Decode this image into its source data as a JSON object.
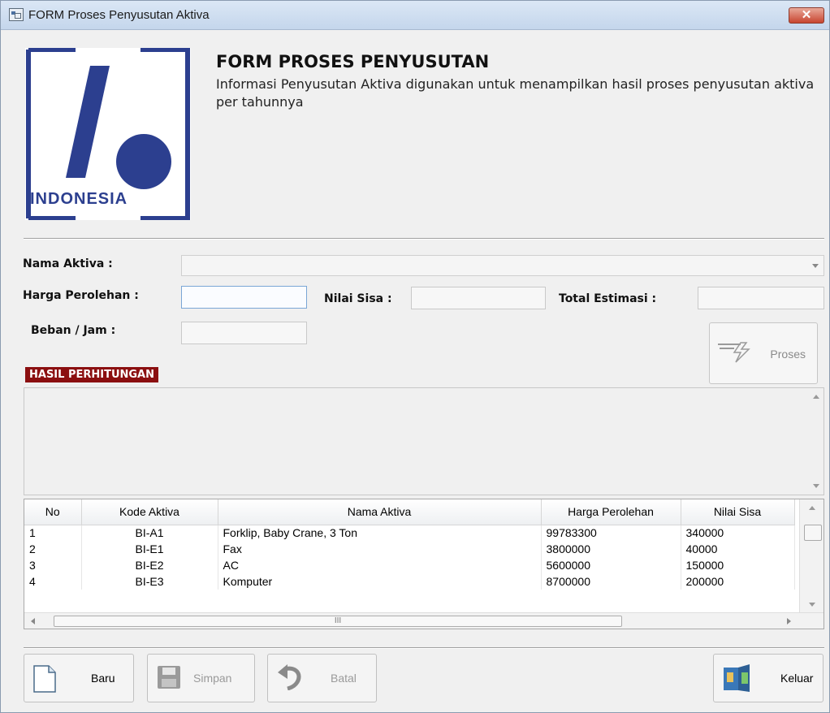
{
  "window": {
    "title": "FORM Proses  Penyusutan Aktiva",
    "close_label": "✕"
  },
  "logo": {
    "text": "INDONESIA"
  },
  "header": {
    "title": "FORM PROSES PENYUSUTAN",
    "description": "Informasi Penyusutan Aktiva digunakan untuk menampilkan hasil proses penyusutan aktiva per tahunnya"
  },
  "form": {
    "nama_aktiva_label": "Nama Aktiva :",
    "nama_aktiva_value": "",
    "harga_perolehan_label": "Harga Perolehan :",
    "nilai_sisa_label": "Nilai Sisa :",
    "total_estimasi_label": "Total Estimasi :",
    "beban_jam_label": "Beban / Jam :",
    "proses_label": "Proses"
  },
  "hasil": {
    "label": "HASIL PERHITUNGAN"
  },
  "grid": {
    "columns": [
      "No",
      "Kode Aktiva",
      "Nama Aktiva",
      "Harga Perolehan",
      "Nilai Sisa"
    ],
    "rows": [
      [
        "1",
        "BI-A1",
        "Forklip, Baby Crane, 3 Ton",
        "99783300",
        "340000"
      ],
      [
        "2",
        "BI-E1",
        "Fax",
        "3800000",
        "40000"
      ],
      [
        "3",
        "BI-E2",
        "AC",
        "5600000",
        "150000"
      ],
      [
        "4",
        "BI-E3",
        "Komputer",
        "8700000",
        "200000"
      ]
    ],
    "hscroll_grip": "III"
  },
  "buttons": {
    "baru": "Baru",
    "simpan": "Simpan",
    "batal": "Batal",
    "keluar": "Keluar"
  },
  "colors": {
    "hasil_bg": "#8b0f10",
    "logo_blue": "#2c3f8f"
  }
}
